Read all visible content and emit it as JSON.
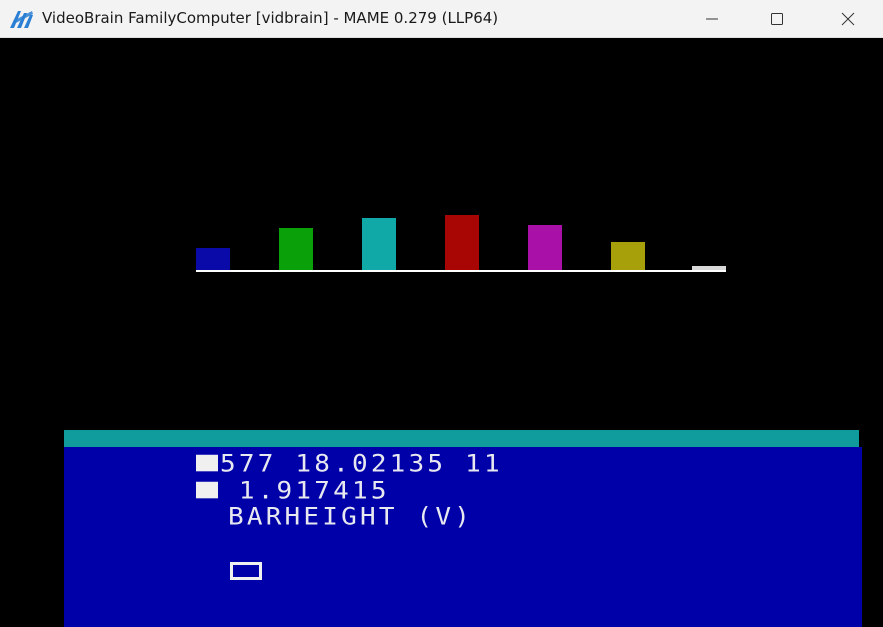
{
  "window": {
    "title": "VideoBrain FamilyComputer [vidbrain] - MAME 0.279 (LLP64)",
    "app_icon": "mame-logo-icon",
    "controls": [
      "minimize-icon",
      "maximize-icon",
      "close-icon"
    ]
  },
  "screen": {
    "background": "#000000",
    "baseline_color": "#ffffff",
    "bars": [
      {
        "color": "#0a0aa8",
        "level": 22
      },
      {
        "color": "#0aa00a",
        "level": 42
      },
      {
        "color": "#11a8a8",
        "level": 52
      },
      {
        "color": "#a80505",
        "level": 55
      },
      {
        "color": "#a810a8",
        "level": 45
      },
      {
        "color": "#a8a00a",
        "level": 28
      },
      {
        "color": "#d8d8d8",
        "level": 4
      }
    ],
    "teal_strip_color": "#109c9c",
    "panel_color": "#0000a8",
    "terminal": {
      "line1": "577 18.02135 11",
      "line2": " 1.917415",
      "line3": "BARHEIGHT (V)"
    }
  }
}
